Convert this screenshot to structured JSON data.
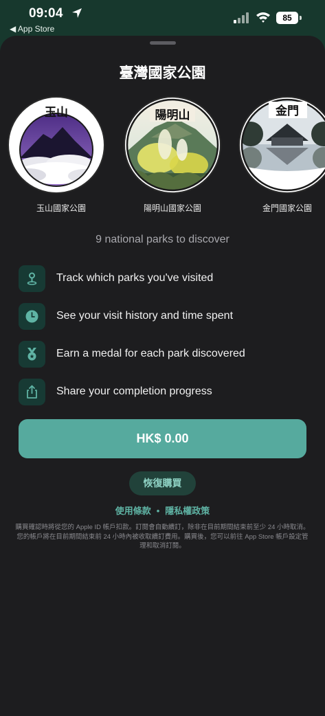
{
  "status_bar": {
    "time": "09:04",
    "back_label": "◀ App Store",
    "battery": "85",
    "icons": [
      "location-arrow-icon",
      "signal-icon",
      "wifi-icon",
      "battery-icon"
    ]
  },
  "sheet": {
    "title": "臺灣國家公園",
    "parks": [
      {
        "badge_text": "玉山",
        "label": "玉山國家公園"
      },
      {
        "badge_text": "陽明山",
        "label": "陽明山國家公園"
      },
      {
        "badge_text": "金門",
        "label": "金門國家公園"
      }
    ],
    "subtitle": "9 national parks to discover",
    "features": [
      {
        "icon": "map-pin-icon",
        "text": "Track which parks you've visited"
      },
      {
        "icon": "clock-icon",
        "text": "See your visit history and time spent"
      },
      {
        "icon": "medal-icon",
        "text": "Earn a medal for each park discovered"
      },
      {
        "icon": "share-icon",
        "text": "Share your completion progress"
      }
    ],
    "buy_label": "HK$ 0.00",
    "restore_label": "恢復購買",
    "terms_label": "使用條款",
    "privacy_label": "隱私權政策",
    "legal_text": "購買確認時將從您的 Apple ID 帳戶扣款。訂閱會自動續訂，除非在目前期間結束前至少 24 小時取消。您的帳戶將在目前期間結束前 24 小時內被收取續訂費用。購買後，您可以前往 App Store 帳戶設定管理和取消訂閱。"
  },
  "colors": {
    "accent": "#56aa9e",
    "link": "#5fb3a4",
    "sheet_bg": "#1d1d1f",
    "icon_tile": "#173a34"
  }
}
